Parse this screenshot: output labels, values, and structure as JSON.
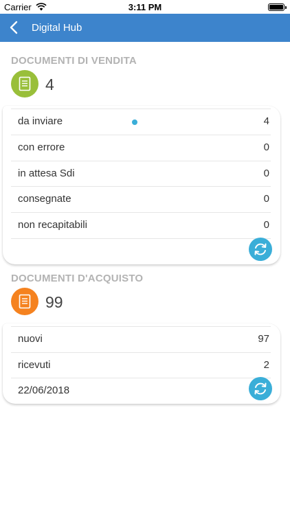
{
  "status_bar": {
    "carrier": "Carrier",
    "time": "3:11 PM"
  },
  "nav": {
    "title": "Digital Hub",
    "back_icon": "chevron-left-icon"
  },
  "sales": {
    "heading": "DOCUMENTI DI VENDITA",
    "count": "4",
    "badge_color": "#99bf3a",
    "rows": [
      {
        "label": "da inviare",
        "value": "4"
      },
      {
        "label": "con errore",
        "value": "0"
      },
      {
        "label": "in attesa Sdi",
        "value": "0"
      },
      {
        "label": "consegnate",
        "value": "0"
      },
      {
        "label": "non recapitabili",
        "value": "0"
      }
    ],
    "footer_text": ""
  },
  "purchase": {
    "heading": "DOCUMENTI D'ACQUISTO",
    "count": "99",
    "badge_color": "#f5821f",
    "rows": [
      {
        "label": "nuovi",
        "value": "97"
      },
      {
        "label": "ricevuti",
        "value": "2"
      }
    ],
    "footer_text": "22/06/2018"
  },
  "colors": {
    "nav": "#3d84cc",
    "refresh": "#3aaed8",
    "heading": "#b3b3b3"
  }
}
